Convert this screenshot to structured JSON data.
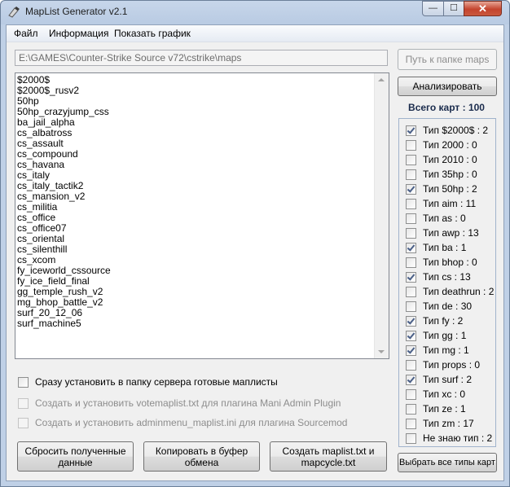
{
  "window": {
    "title": "MapList Generator v2.1",
    "min_symbol": "—",
    "max_symbol": "☐",
    "close_symbol": "✕"
  },
  "menu": [
    "Файл",
    "Информация",
    "Показать график"
  ],
  "path": {
    "value": "E:\\GAMES\\Counter-Strike Source v72\\cstrike\\maps"
  },
  "buttons": {
    "path_to_folder": "Путь к папке maps",
    "analyze": "Анализировать",
    "reset": "Сбросить полученные данные",
    "copy": "Копировать в буфер обмена",
    "create": "Создать maplist.txt и mapcycle.txt",
    "select_all": "Выбрать все типы карт"
  },
  "maps": [
    "$2000$",
    "$2000$_rusv2",
    "50hp",
    "50hp_crazyjump_css",
    "ba_jail_alpha",
    "cs_albatross",
    "cs_assault",
    "cs_compound",
    "cs_havana",
    "cs_italy",
    "cs_italy_tactik2",
    "cs_mansion_v2",
    "cs_militia",
    "cs_office",
    "cs_office07",
    "cs_oriental",
    "cs_silenthill",
    "cs_xcom",
    "fy_iceworld_cssource",
    "fy_ice_field_final",
    "gg_temple_rush_v2",
    "mg_bhop_battle_v2",
    "surf_20_12_06",
    "surf_machine5"
  ],
  "options": [
    {
      "label": "Сразу установить в папку сервера готовые маплисты",
      "checked": false,
      "disabled": false
    },
    {
      "label": "Создать и установить votemaplist.txt для плагина Mani Admin Plugin",
      "checked": false,
      "disabled": true
    },
    {
      "label": "Создать и установить adminmenu_maplist.ini для плагина Sourcemod",
      "checked": false,
      "disabled": true
    }
  ],
  "total": "Всего карт : 100",
  "types": [
    {
      "label": "Тип $2000$ : 2",
      "checked": true
    },
    {
      "label": "Тип 2000 : 0",
      "checked": false
    },
    {
      "label": "Тип 2010 : 0",
      "checked": false
    },
    {
      "label": "Тип 35hp : 0",
      "checked": false
    },
    {
      "label": "Тип 50hp : 2",
      "checked": true
    },
    {
      "label": "Тип aim : 11",
      "checked": false
    },
    {
      "label": "Тип as : 0",
      "checked": false
    },
    {
      "label": "Тип awp : 13",
      "checked": false
    },
    {
      "label": "Тип ba : 1",
      "checked": true
    },
    {
      "label": "Тип bhop : 0",
      "checked": false
    },
    {
      "label": "Тип cs : 13",
      "checked": true
    },
    {
      "label": "Тип deathrun : 2",
      "checked": false
    },
    {
      "label": "Тип de : 30",
      "checked": false
    },
    {
      "label": "Тип fy : 2",
      "checked": true
    },
    {
      "label": "Тип gg : 1",
      "checked": true
    },
    {
      "label": "Тип mg : 1",
      "checked": true
    },
    {
      "label": "Тип props : 0",
      "checked": false
    },
    {
      "label": "Тип surf : 2",
      "checked": true
    },
    {
      "label": "Тип xc : 0",
      "checked": false
    },
    {
      "label": "Тип ze : 1",
      "checked": false
    },
    {
      "label": "Тип zm : 17",
      "checked": false
    },
    {
      "label": "Не знаю тип : 2",
      "checked": false
    }
  ]
}
